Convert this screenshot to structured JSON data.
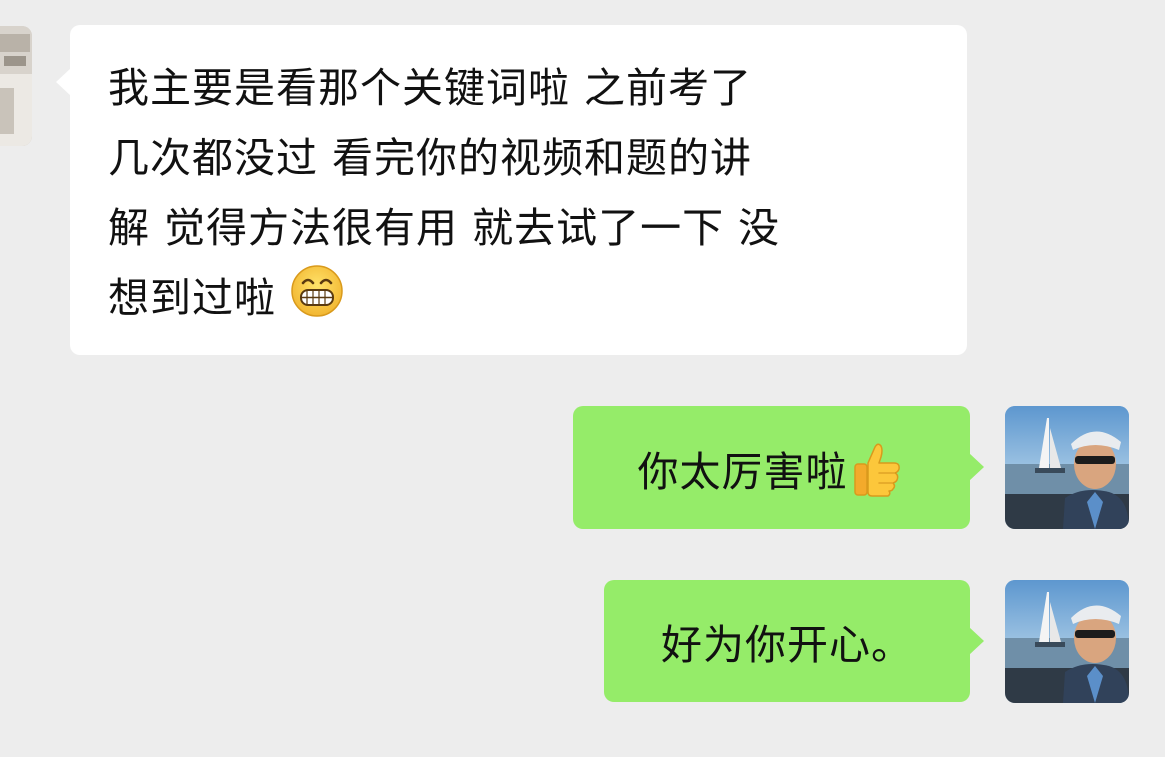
{
  "conversation": {
    "incoming": {
      "lines": [
        "我主要是看那个关键词啦  之前考了",
        "几次都没过  看完你的视频和题的讲",
        "解  觉得方法很有用  就去试了一下 没",
        "想到过啦"
      ],
      "emoji": "grinning-face"
    },
    "outgoing": [
      {
        "text": "你太厉害啦",
        "emoji": "thumbs-up"
      },
      {
        "text": "好为你开心。",
        "emoji": ""
      }
    ]
  },
  "colors": {
    "background": "#ededed",
    "incoming_bubble": "#ffffff",
    "outgoing_bubble": "#95ec69"
  }
}
